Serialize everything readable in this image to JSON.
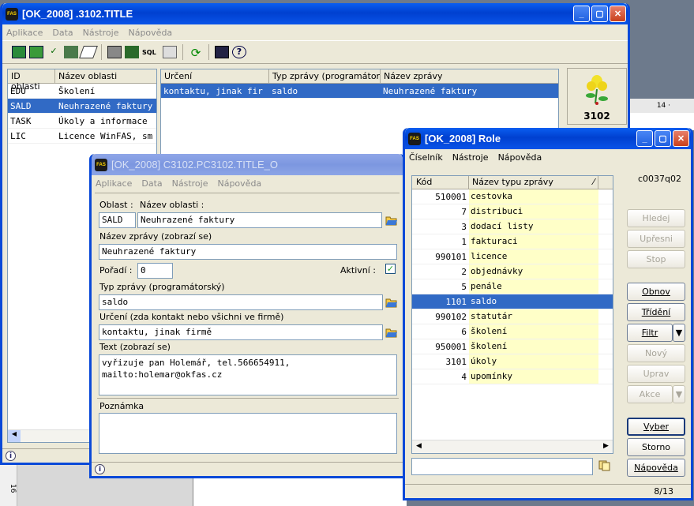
{
  "main": {
    "title": "[OK_2008] .3102.TITLE",
    "menu": [
      "Aplikace",
      "Data",
      "Nástroje",
      "Nápověda"
    ],
    "left_grid": {
      "headers": [
        "ID oblasti",
        "Název oblasti"
      ],
      "rows": [
        [
          "EDU",
          "Školení"
        ],
        [
          "SALD",
          "Neuhrazené faktury"
        ],
        [
          "TASK",
          "Úkoly a informace"
        ],
        [
          "LIC",
          "Licence WinFAS, sm"
        ]
      ]
    },
    "right_grid": {
      "headers": [
        "Určení",
        "Typ zprávy (programátorský)",
        "Název zprávy"
      ],
      "row": [
        "kontaktu, jinak fir",
        "saldo",
        "Neuhrazené faktury"
      ]
    },
    "logo_number": "3102"
  },
  "detail": {
    "title": "[OK_2008] C3102.PC3102.TITLE_O",
    "menu": [
      "Aplikace",
      "Data",
      "Nástroje",
      "Nápověda"
    ],
    "oblast_label": "Oblast :",
    "nazev_oblasti_label": "Název oblasti :",
    "oblast_value": "SALD",
    "nazev_oblasti_value": "Neuhrazené faktury",
    "nazev_zpravy_label": "Název zprávy (zobrazí se)",
    "nazev_zpravy_value": "Neuhrazené faktury",
    "poradi_label": "Pořadí :",
    "poradi_value": "0",
    "aktivni_label": "Aktivní :",
    "aktivni_check": "✓",
    "typ_label": "Typ zprávy (programátorský)",
    "typ_value": "saldo",
    "urceni_label": "Určení (zda kontakt nebo všichni ve firmě)",
    "urceni_value": "kontaktu, jinak firmě",
    "text_label": "Text (zobrazí se)",
    "text_line1": "vyřizuje pan Holemář, tel.566654911,",
    "text_line2": "mailto:holemar@okfas.cz",
    "poznamka_label": "Poznámka"
  },
  "role": {
    "title": "[OK_2008] Role",
    "menu": [
      "Číselník",
      "Nástroje",
      "Nápověda"
    ],
    "code_label": "c0037q02",
    "headers": [
      "Kód",
      "Název typu zprávy"
    ],
    "rows": [
      [
        "510001",
        "cestovka"
      ],
      [
        "7",
        "distribuci"
      ],
      [
        "3",
        "dodací listy"
      ],
      [
        "1",
        "fakturaci"
      ],
      [
        "990101",
        "licence"
      ],
      [
        "2",
        "objednávky"
      ],
      [
        "5",
        "penále"
      ],
      [
        "1101",
        "saldo"
      ],
      [
        "990102",
        "statutár"
      ],
      [
        "6",
        "školení"
      ],
      [
        "950001",
        "školení"
      ],
      [
        "3101",
        "úkoly"
      ],
      [
        "4",
        "upomínky"
      ]
    ],
    "selected_index": 7,
    "buttons": [
      "Hledej",
      "Upřesni",
      "Stop",
      "Obnov",
      "Třídění",
      "Filtr",
      "Nový",
      "Uprav",
      "Akce",
      "Vyber",
      "Storno",
      "Nápověda"
    ],
    "status": "8/13"
  },
  "bg_ruler": {
    "marks": "14 ·",
    "side": "16"
  },
  "colors": {
    "selection": "#316ac5",
    "yellow_cell": "#ffffc8",
    "title_active": "#0a5ef0"
  }
}
